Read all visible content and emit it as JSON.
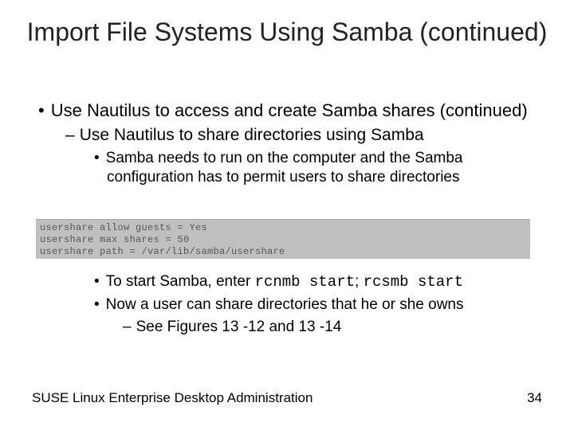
{
  "title": "Import File Systems Using Samba (continued)",
  "bullets": {
    "l1": "Use Nautilus to access and create Samba shares (continued)",
    "l2": "Use Nautilus to share directories using Samba",
    "l3a": "Samba needs to run on the computer and the Samba configuration has to permit users to share directories",
    "l3b_pre": "To start Samba, enter ",
    "l3b_code_a": "rcnmb start",
    "l3b_sep": "; ",
    "l3b_code_b": "rcsmb start",
    "l3c": "Now a user can share directories that he or she owns",
    "l4": "See Figures 13 -12 and 13 -14"
  },
  "code": "usershare allow guests = Yes\nusershare max shares = 50\nusershare path = /var/lib/samba/usershare",
  "footer": {
    "left": "SUSE Linux Enterprise Desktop Administration",
    "page": "34"
  }
}
